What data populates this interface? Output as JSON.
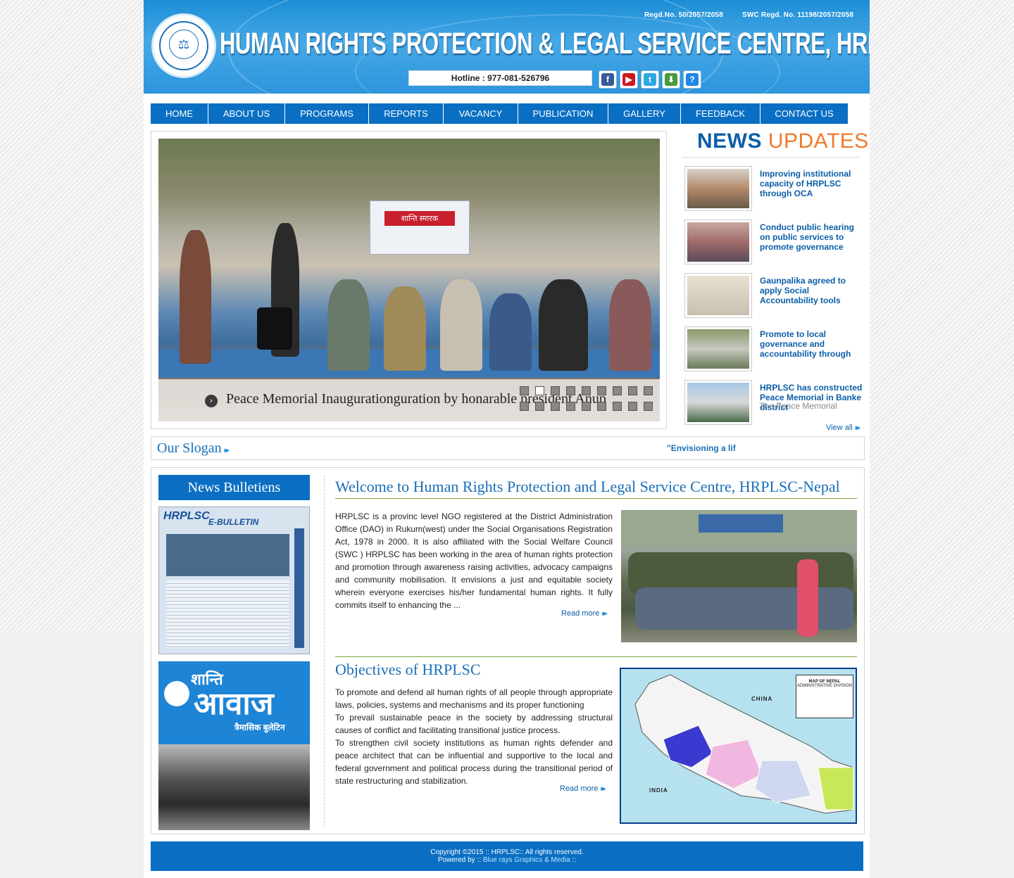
{
  "header": {
    "regd_no": "Regd.No. 50/2057/2058",
    "swc_regd_no": "SWC Regd. No. 11198/2057/2058",
    "title": "HUMAN RIGHTS PROTECTION & LEGAL SERVICE CENTRE, HRPLSC- NEPAL",
    "hotline": "Hotline : 977-081-526796",
    "social": [
      {
        "name": "facebook-icon",
        "glyph": "f",
        "color": "#3b5998"
      },
      {
        "name": "youtube-icon",
        "glyph": "▶",
        "color": "#cc181e"
      },
      {
        "name": "twitter-icon",
        "glyph": "t",
        "color": "#2fa9e1"
      },
      {
        "name": "download-icon",
        "glyph": "⬇",
        "color": "#4a9a3a"
      },
      {
        "name": "help-icon",
        "glyph": "?",
        "color": "#1e88e5"
      }
    ]
  },
  "nav": {
    "items": [
      "HOME",
      "ABOUT US",
      "PROGRAMS",
      "REPORTS",
      "VACANCY",
      "PUBLICATION",
      "GALLERY",
      "FEEDBACK",
      "CONTACT US"
    ]
  },
  "slider": {
    "caption": "Peace Memorial Inaugurationguration by honarable president Anup",
    "banner_text": "शान्ति स्मारक",
    "active_dot": 1,
    "dot_count": 18
  },
  "news": {
    "heading_bold": "NEWS",
    "heading_light": "UPDATES",
    "items": [
      {
        "title": "Improving institutional capacity of HRPLSC through OCA"
      },
      {
        "title": "Conduct public hearing on public services to promote governance"
      },
      {
        "title": "Gaunpalika agreed to apply Social Accountability tools"
      },
      {
        "title": "Promote to local governance and accountability through"
      },
      {
        "title": "HRPLSC has constructed Peace Memorial in Banke district"
      }
    ],
    "overflow_text": "The Peace Memorial",
    "view_all": "View all"
  },
  "slogan": {
    "label": "Our Slogan",
    "text": "\"Envisioning a lif"
  },
  "bulletins": {
    "title": "News Bulletiens",
    "items": [
      {
        "heading": "HRPLSC",
        "sub": "E-BULLETIN"
      },
      {
        "heading": "शान्ति",
        "sub": "आवाज",
        "tag": "त्रैमासिक बुलेटिन"
      }
    ]
  },
  "welcome": {
    "heading": "Welcome to Human Rights Protection and Legal Service Centre, HRPLSC-Nepal",
    "body": "HRPLSC is a provinc level NGO registered at the District Administration Office (DAO) in Rukum(west) under the Social Organisations Registration Act, 1978 in 2000. It is also affiliated with the Social Welfare Council (SWC ) HRPLSC has been working in the area of human rights protection and promotion through awareness raising activities, advocacy campaigns and community mobilisation. It envisions a just and equitable society wherein everyone exercises his/her fundamental human rights. It fully commits itself to enhancing the ...",
    "read_more": "Read more"
  },
  "objectives": {
    "heading": "Objectives of HRPLSC",
    "items": [
      "To promote and defend all human rights of all people through appropriate laws, policies, systems and mechanisms and its proper functioning",
      "To prevail sustainable peace in the society by addressing structural causes of conflict and facilitating transitional justice process.",
      "To strengthen civil society institutions as human rights defender and peace architect that can be influential and supportive to the local and federal government and political process during the transitional period of state restructuring and stabilization."
    ],
    "read_more": "Read more",
    "map": {
      "title": "MAP OF NEPAL",
      "subtitle": "ADMINISTRATIVE DIVISION",
      "china": "CHINA",
      "india": "INDIA"
    }
  },
  "footer": {
    "copyright": "Copyright ©2015 :: HRPLSC:: All rights reserved.",
    "powered_prefix": "Powered by ::",
    "powered_link": "Blue rays Graphics & Media",
    "powered_suffix": "::"
  }
}
